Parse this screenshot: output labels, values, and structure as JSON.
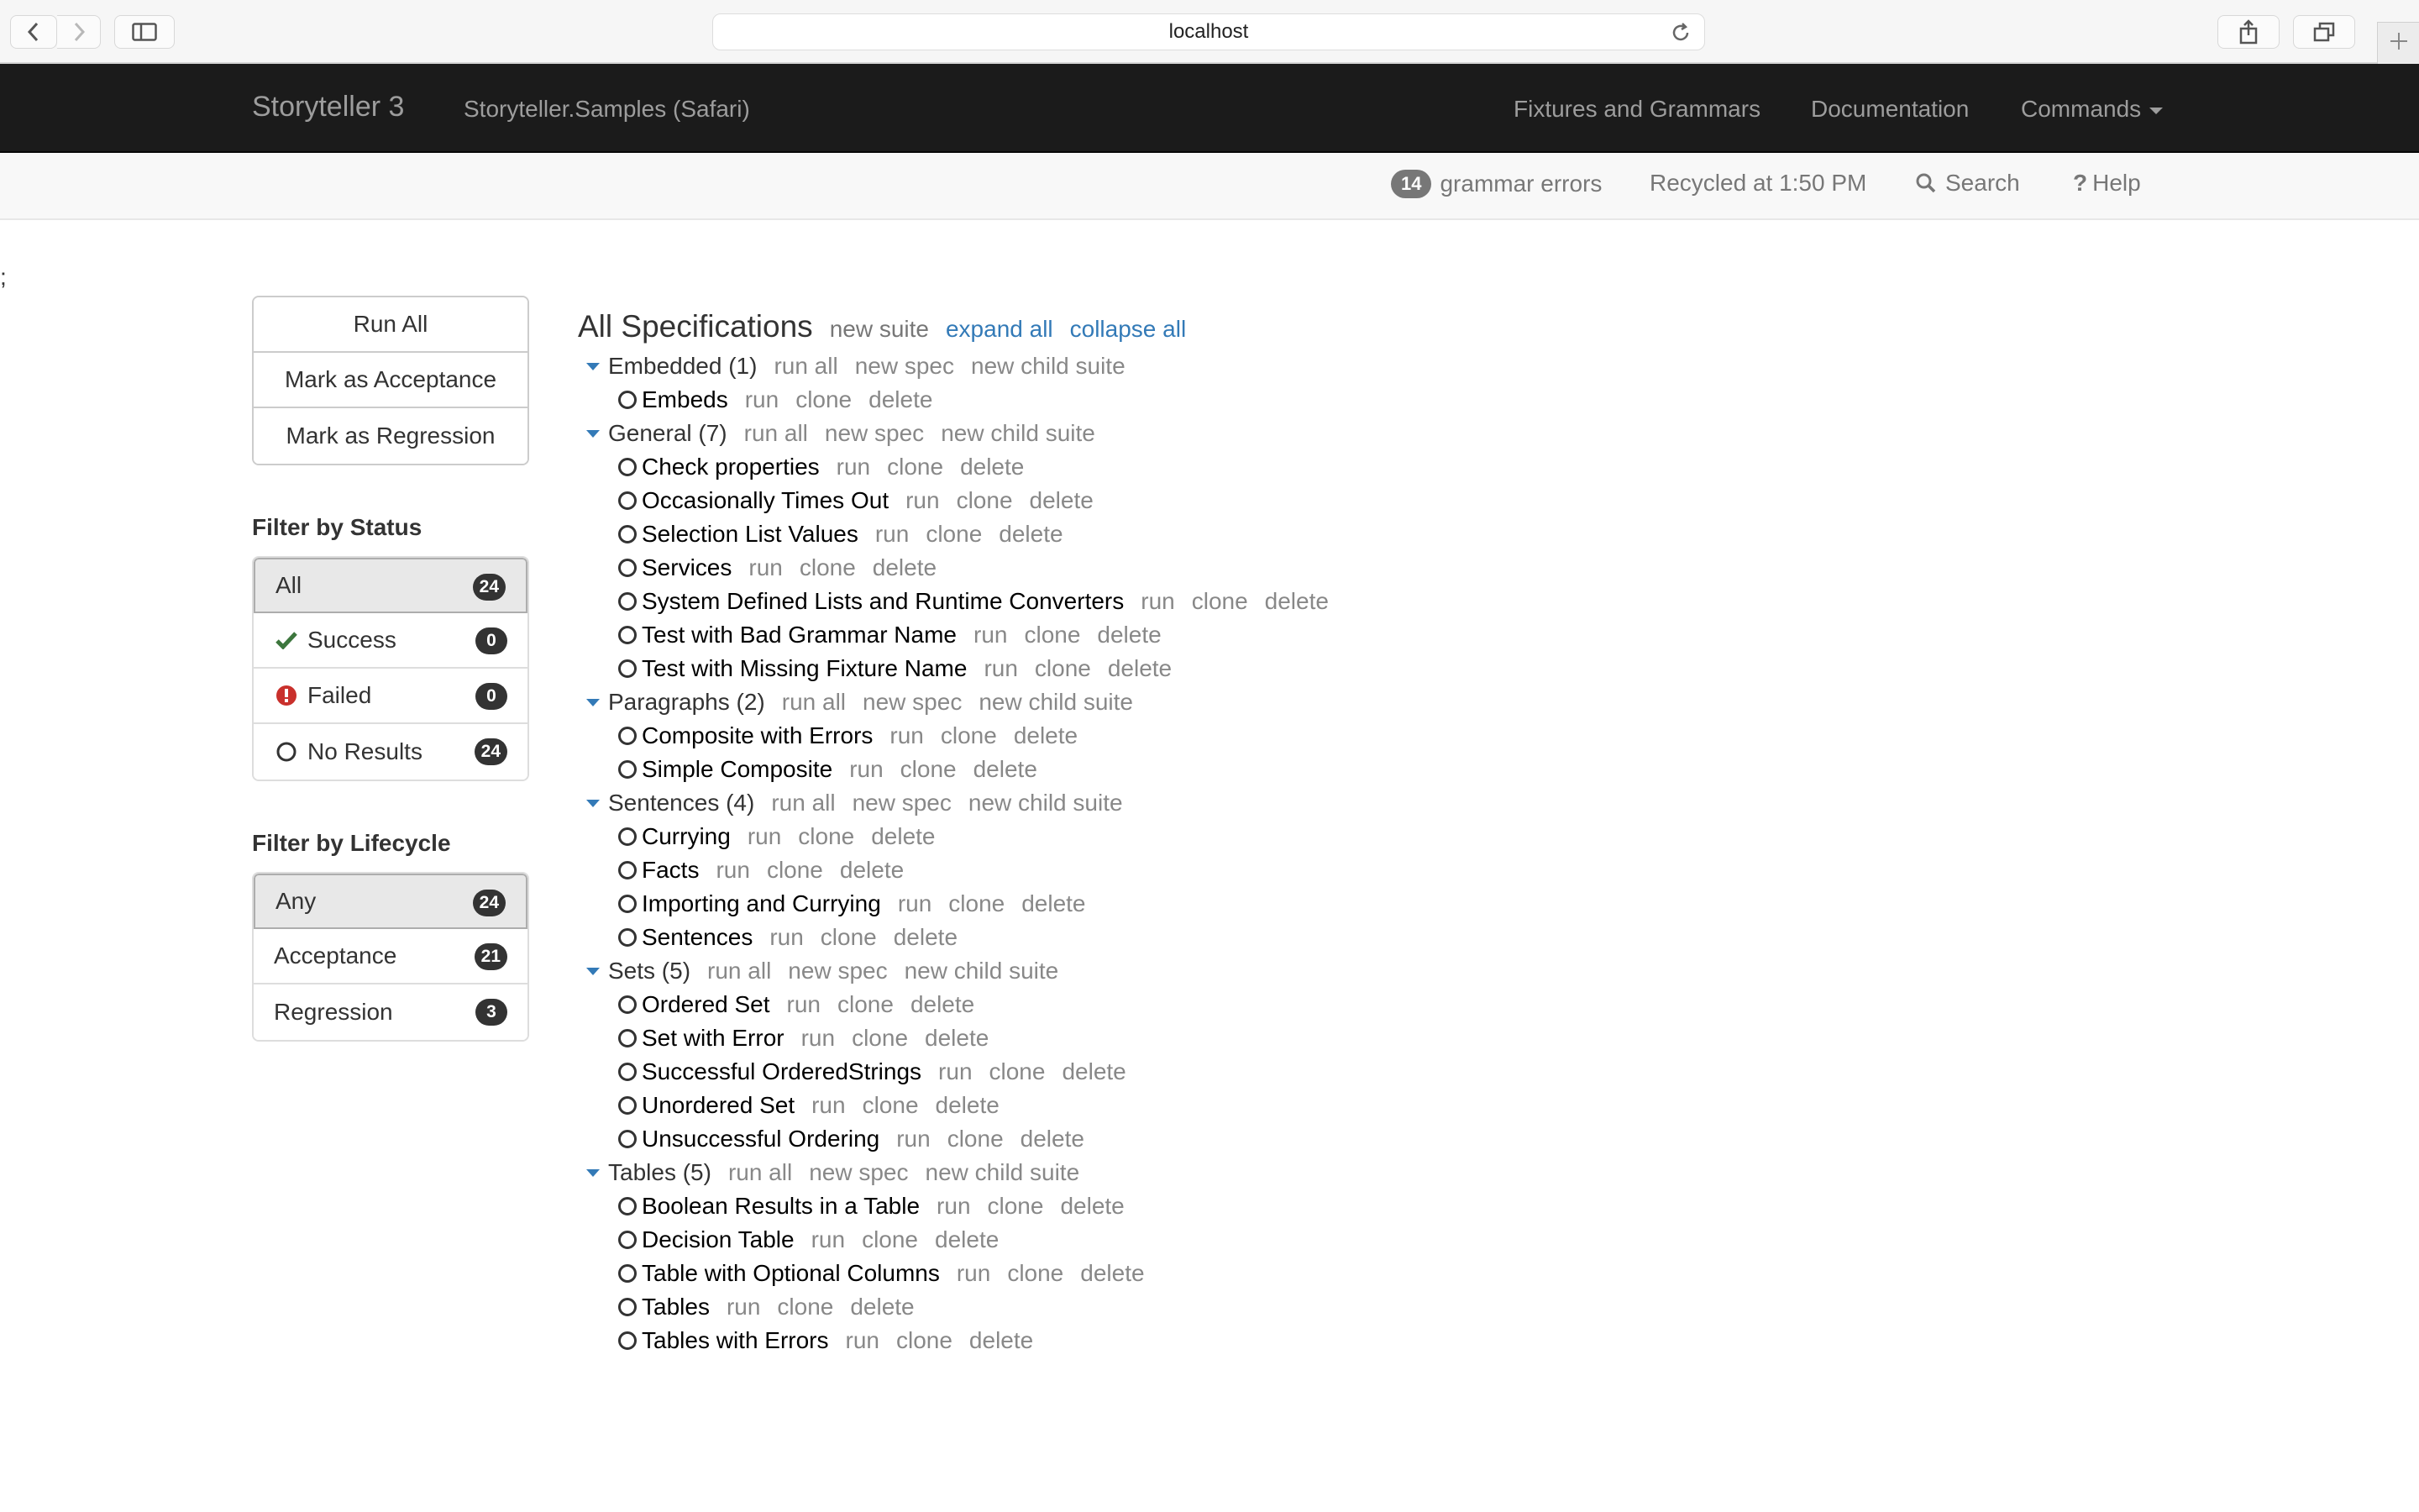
{
  "browser": {
    "url": "localhost",
    "icons": {
      "back": "chevron-left-icon",
      "forward": "chevron-right-icon",
      "sidebar": "sidebar-icon",
      "reload": "reload-icon",
      "share": "share-icon",
      "tabs": "tabs-icon",
      "new_tab": "plus-icon"
    }
  },
  "navbar": {
    "brand": "Storyteller 3",
    "project": "Storyteller.Samples (Safari)",
    "links": [
      "Fixtures and Grammars",
      "Documentation"
    ],
    "commands": "Commands"
  },
  "statusbar": {
    "grammar_error_count": "14",
    "grammar_errors_label": "grammar errors",
    "recycled": "Recycled at 1:50 PM",
    "search": "Search",
    "help_icon": "?",
    "help": "Help"
  },
  "stray_text": ";",
  "actions": {
    "run_all": "Run All",
    "mark_acceptance": "Mark as Acceptance",
    "mark_regression": "Mark as Regression"
  },
  "filter_status": {
    "title": "Filter by Status",
    "items": [
      {
        "label": "All",
        "count": "24",
        "icon": "none"
      },
      {
        "label": "Success",
        "count": "0",
        "icon": "check-icon"
      },
      {
        "label": "Failed",
        "count": "0",
        "icon": "error-icon"
      },
      {
        "label": "No Results",
        "count": "24",
        "icon": "circle-icon"
      }
    ]
  },
  "filter_lifecycle": {
    "title": "Filter by Lifecycle",
    "items": [
      {
        "label": "Any",
        "count": "24"
      },
      {
        "label": "Acceptance",
        "count": "21"
      },
      {
        "label": "Regression",
        "count": "3"
      }
    ]
  },
  "tree": {
    "title": "All Specifications",
    "new_suite": "new suite",
    "expand_all": "expand all",
    "collapse_all": "collapse all",
    "suite_actions": [
      "run all",
      "new spec",
      "new child suite"
    ],
    "spec_actions": [
      "run",
      "clone",
      "delete"
    ],
    "suites": [
      {
        "name": "Embedded (1)",
        "specs": [
          "Embeds"
        ]
      },
      {
        "name": "General (7)",
        "specs": [
          "Check properties",
          "Occasionally Times Out",
          "Selection List Values",
          "Services",
          "System Defined Lists and Runtime Converters",
          "Test with Bad Grammar Name",
          "Test with Missing Fixture Name"
        ]
      },
      {
        "name": "Paragraphs (2)",
        "specs": [
          "Composite with Errors",
          "Simple Composite"
        ]
      },
      {
        "name": "Sentences (4)",
        "specs": [
          "Currying",
          "Facts",
          "Importing and Currying",
          "Sentences"
        ]
      },
      {
        "name": "Sets (5)",
        "specs": [
          "Ordered Set",
          "Set with Error",
          "Successful OrderedStrings",
          "Unordered Set",
          "Unsuccessful Ordering"
        ]
      },
      {
        "name": "Tables (5)",
        "specs": [
          "Boolean Results in a Table",
          "Decision Table",
          "Table with Optional Columns",
          "Tables",
          "Tables with Errors"
        ]
      }
    ]
  },
  "colors": {
    "navbar_bg": "#1b1b1b",
    "link_blue": "#337ab7",
    "success_green": "#3c763d",
    "failed_red": "#c9302c",
    "badge_bg": "#333333"
  }
}
